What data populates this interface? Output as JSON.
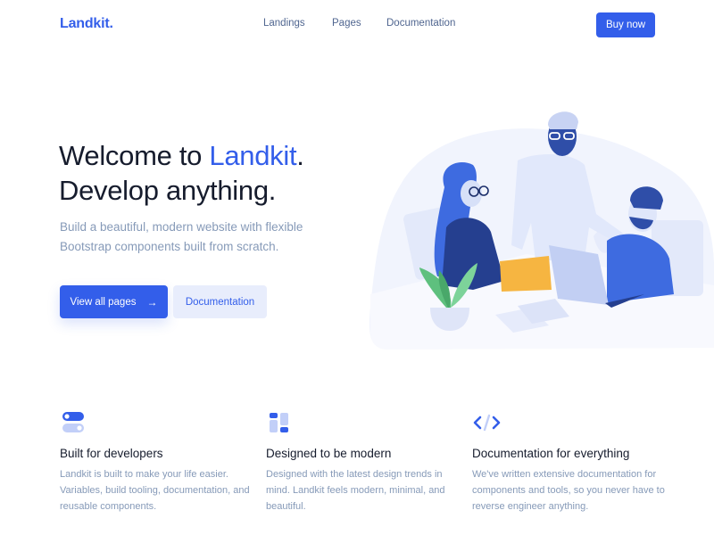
{
  "navbar": {
    "brand": "Landkit.",
    "links": [
      {
        "label": "Landings"
      },
      {
        "label": "Pages"
      },
      {
        "label": "Documentation"
      }
    ],
    "cta_label": "Buy now"
  },
  "hero": {
    "title_prefix": "Welcome to ",
    "title_accent": "Landkit",
    "title_suffix": ".",
    "title_line2": "Develop anything.",
    "lead": "Build a beautiful, modern website with flexible Bootstrap components built from scratch.",
    "primary_button": "View all pages",
    "primary_button_icon": "→",
    "secondary_button": "Documentation",
    "illustration_alt": "Team working at a table illustration"
  },
  "features": [
    {
      "icon": "toggle-icon",
      "title": "Built for developers",
      "text": "Landkit is built to make your life easier. Variables, build tooling, documentation, and reusable components."
    },
    {
      "icon": "layout-icon",
      "title": "Designed to be modern",
      "text": "Designed with the latest design trends in mind. Landkit feels modern, minimal, and beautiful."
    },
    {
      "icon": "code-icon",
      "title": "Documentation for everything",
      "text": "We've written extensive documentation for components and tools, so you never have to reverse engineer anything."
    }
  ],
  "colors": {
    "primary": "#335eea",
    "primary_soft": "#e8edfc",
    "text_dark": "#161c2d",
    "text_muted": "#869ab8",
    "nav_text": "#506690"
  }
}
